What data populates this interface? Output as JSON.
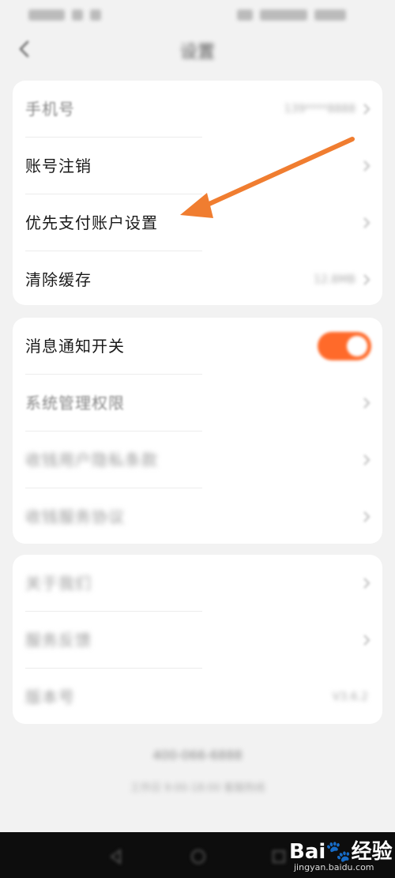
{
  "header": {
    "title": "设置"
  },
  "sections": [
    {
      "rows": [
        {
          "label": "手机号",
          "value": "139****8888",
          "type": "value"
        },
        {
          "label": "账号注销",
          "type": "chevron"
        },
        {
          "label": "优先支付账户设置",
          "type": "chevron"
        },
        {
          "label": "清除缓存",
          "value": "12.8MB",
          "type": "value-chevron"
        }
      ]
    },
    {
      "rows": [
        {
          "label": "消息通知开关",
          "type": "toggle",
          "toggle_on": true
        },
        {
          "label": "系统管理权限",
          "type": "chevron"
        },
        {
          "label": "收钱用户隐私条款",
          "type": "chevron"
        },
        {
          "label": "收钱服务协议",
          "type": "chevron"
        }
      ]
    },
    {
      "rows": [
        {
          "label": "关于我们",
          "type": "chevron"
        },
        {
          "label": "服务反馈",
          "type": "chevron"
        },
        {
          "label": "版本号",
          "value": "V3.6.2",
          "type": "value"
        }
      ]
    }
  ],
  "footer": {
    "phone": "400-066-6888",
    "sub": "工作日 9:00-18:00 客服热线"
  },
  "watermark": {
    "brand": "Bai🐾经验",
    "url": "jingyan.baidu.com"
  },
  "colors": {
    "accent": "#ff6a2a",
    "arrow": "#f07d30",
    "background": "#f2f2f2",
    "card": "#ffffff"
  }
}
